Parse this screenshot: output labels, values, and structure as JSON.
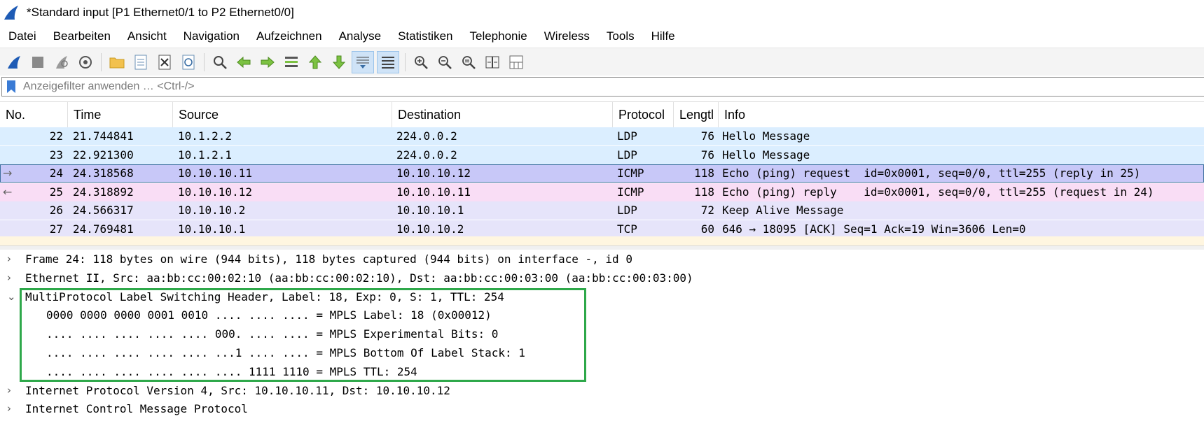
{
  "window": {
    "title": "*Standard input [P1 Ethernet0/1 to P2 Ethernet0/0]"
  },
  "menu": [
    "Datei",
    "Bearbeiten",
    "Ansicht",
    "Navigation",
    "Aufzeichnen",
    "Analyse",
    "Statistiken",
    "Telephonie",
    "Wireless",
    "Tools",
    "Hilfe"
  ],
  "toolbar_icons": [
    "shark-fin-start-icon",
    "stop-icon",
    "restart-icon",
    "capture-options-icon",
    "open-folder-icon",
    "save-file-icon",
    "close-file-icon",
    "reload-icon",
    "find-icon",
    "back-arrow-icon",
    "forward-arrow-icon",
    "goto-packet-icon",
    "first-packet-icon",
    "last-packet-icon",
    "autoscroll-icon",
    "colorize-icon",
    "zoom-in-icon",
    "zoom-out-icon",
    "normal-size-icon",
    "resize-columns-icon",
    "layout-icon"
  ],
  "filter": {
    "placeholder": "Anzeigefilter anwenden … <Ctrl-/>",
    "value": ""
  },
  "packet_list": {
    "columns": [
      "No.",
      "Time",
      "Source",
      "Destination",
      "Protocol",
      "Lengtl",
      "Info"
    ],
    "rows": [
      {
        "no": "22",
        "time": "21.744841",
        "src": "10.1.2.2",
        "dst": "224.0.0.2",
        "proto": "LDP",
        "len": "76",
        "info": "Hello Message",
        "bg": "#dbeeff",
        "marker": ""
      },
      {
        "no": "23",
        "time": "22.921300",
        "src": "10.1.2.1",
        "dst": "224.0.0.2",
        "proto": "LDP",
        "len": "76",
        "info": "Hello Message",
        "bg": "#dbeeff",
        "marker": ""
      },
      {
        "no": "24",
        "time": "24.318568",
        "src": "10.10.10.11",
        "dst": "10.10.10.12",
        "proto": "ICMP",
        "len": "118",
        "info": "Echo (ping) request  id=0x0001, seq=0/0, ttl=255 (reply in 25)",
        "bg": "#c8c8f8",
        "marker": "→"
      },
      {
        "no": "25",
        "time": "24.318892",
        "src": "10.10.10.12",
        "dst": "10.10.10.11",
        "proto": "ICMP",
        "len": "118",
        "info": "Echo (ping) reply    id=0x0001, seq=0/0, ttl=255 (request in 24)",
        "bg": "#f9ddf5",
        "marker": "←"
      },
      {
        "no": "26",
        "time": "24.566317",
        "src": "10.10.10.2",
        "dst": "10.10.10.1",
        "proto": "LDP",
        "len": "72",
        "info": "Keep Alive Message",
        "bg": "#e6e4fa",
        "marker": ""
      },
      {
        "no": "27",
        "time": "24.769481",
        "src": "10.10.10.1",
        "dst": "10.10.10.2",
        "proto": "TCP",
        "len": "60",
        "info": "646 → 18095 [ACK] Seq=1 Ack=19 Win=3606 Len=0",
        "bg": "#e6e4fa",
        "marker": ""
      }
    ]
  },
  "details": [
    {
      "chev": "›",
      "indent": 0,
      "text": "Frame 24: 118 bytes on wire (944 bits), 118 bytes captured (944 bits) on interface -, id 0"
    },
    {
      "chev": "›",
      "indent": 0,
      "text": "Ethernet II, Src: aa:bb:cc:00:02:10 (aa:bb:cc:00:02:10), Dst: aa:bb:cc:00:03:00 (aa:bb:cc:00:03:00)"
    },
    {
      "chev": "⌄",
      "indent": 0,
      "text": "MultiProtocol Label Switching Header, Label: 18, Exp: 0, S: 1, TTL: 254"
    },
    {
      "chev": "",
      "indent": 1,
      "text": "0000 0000 0000 0001 0010 .... .... .... = MPLS Label: 18 (0x00012)"
    },
    {
      "chev": "",
      "indent": 1,
      "text": ".... .... .... .... .... 000. .... .... = MPLS Experimental Bits: 0"
    },
    {
      "chev": "",
      "indent": 1,
      "text": ".... .... .... .... .... ...1 .... .... = MPLS Bottom Of Label Stack: 1"
    },
    {
      "chev": "",
      "indent": 1,
      "text": ".... .... .... .... .... .... 1111 1110 = MPLS TTL: 254"
    },
    {
      "chev": "›",
      "indent": 0,
      "text": "Internet Protocol Version 4, Src: 10.10.10.11, Dst: 10.10.10.12"
    },
    {
      "chev": "›",
      "indent": 0,
      "text": "Internet Control Message Protocol"
    }
  ],
  "colors": {
    "highlight_box": "#2ea84a",
    "wireshark_blue": "#1e5bb5"
  }
}
